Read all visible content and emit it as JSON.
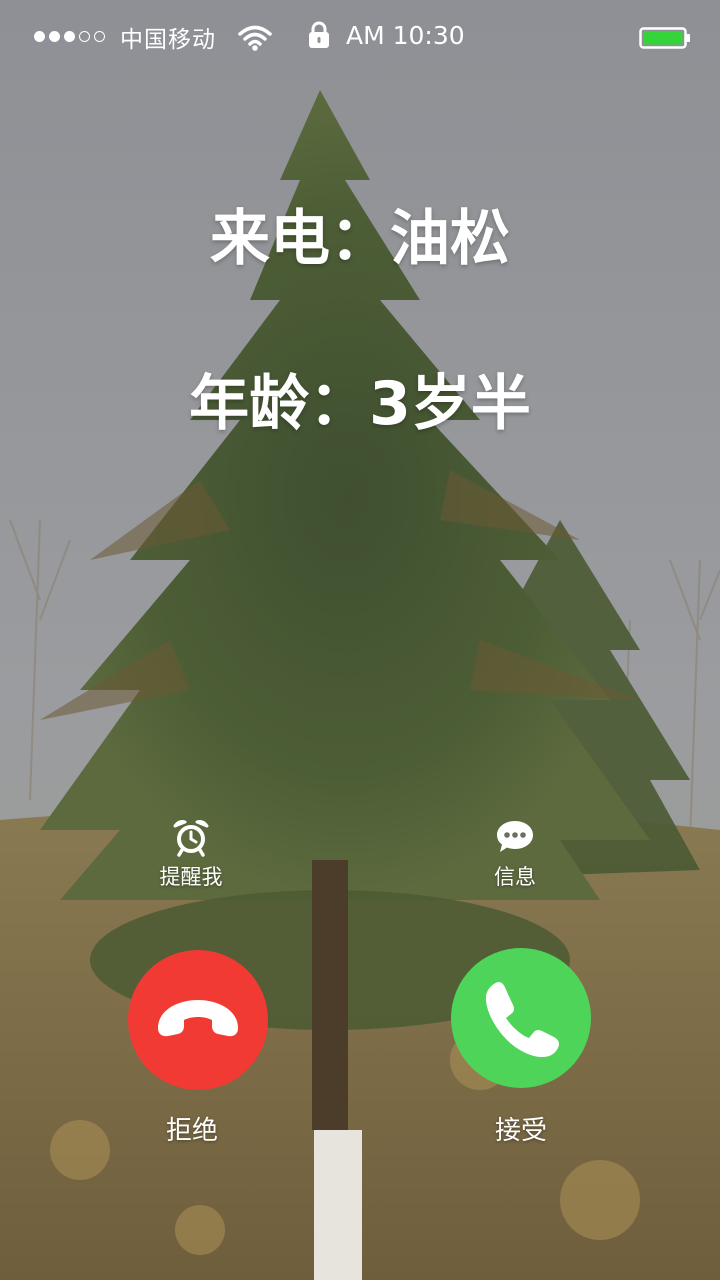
{
  "status_bar": {
    "carrier": "中国移动",
    "time": "AM 10:30",
    "signal_filled": 3,
    "signal_total": 5,
    "battery_level": 1.0,
    "battery_color": "#35d43a",
    "icons": [
      "wifi-icon",
      "lock-icon",
      "battery-icon"
    ]
  },
  "caller": {
    "name_line": "来电：油松",
    "age_line": "年龄：3岁半"
  },
  "actions": {
    "remind": {
      "label": "提醒我",
      "icon": "alarm-clock-icon"
    },
    "message": {
      "label": "信息",
      "icon": "chat-bubble-icon"
    }
  },
  "call_buttons": {
    "decline": {
      "label": "拒绝",
      "icon": "hang-up-phone-icon",
      "color": "#f23a35"
    },
    "accept": {
      "label": "接受",
      "icon": "phone-icon",
      "color": "#4fd45a"
    }
  }
}
